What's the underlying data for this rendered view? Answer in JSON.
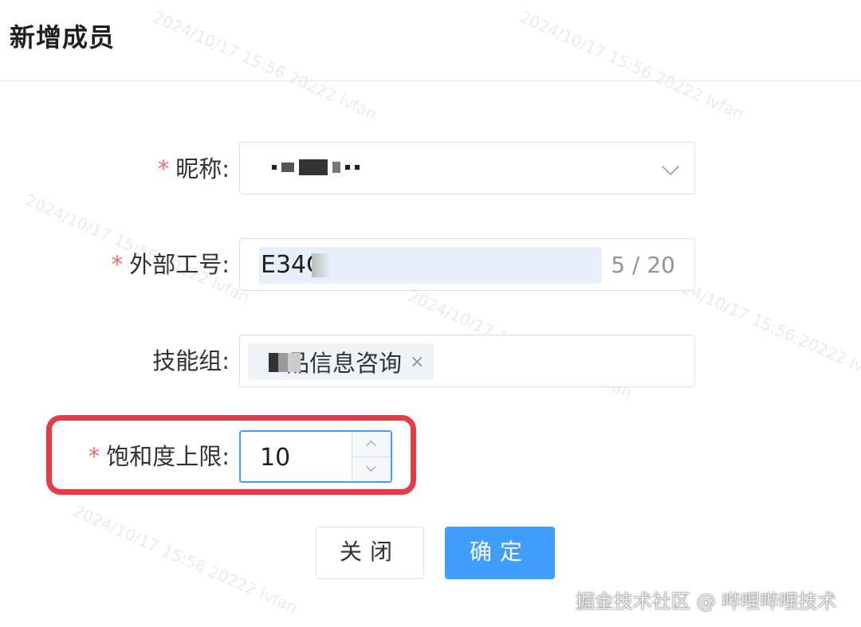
{
  "dialog": {
    "title": "新增成员"
  },
  "form": {
    "nickname": {
      "label": "昵称:",
      "required_mark": "*"
    },
    "external_id": {
      "label": "外部工号:",
      "required_mark": "*",
      "value": "E34C",
      "counter": "5 / 20"
    },
    "skill_group": {
      "label": "技能组:",
      "tag": "品信息咨询",
      "tag_close": "×"
    },
    "saturation": {
      "label": "饱和度上限:",
      "required_mark": "*",
      "value": "10"
    }
  },
  "buttons": {
    "close": "关闭",
    "confirm": "确定"
  },
  "footer": {
    "watermark_text": "掘金技术社区 @ 哔哩哔哩技术"
  },
  "colors": {
    "primary": "#409eff",
    "required": "#f56c6c",
    "highlight": "#e63b45"
  }
}
